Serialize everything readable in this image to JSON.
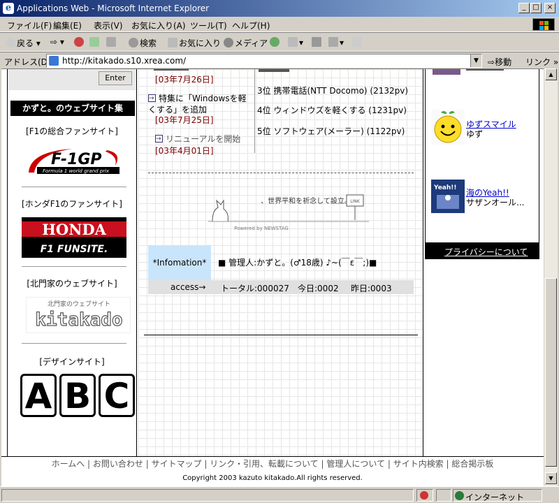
{
  "window": {
    "title": "Applications Web - Microsoft Internet Explorer",
    "min": "_",
    "max": "□",
    "close": "×"
  },
  "menu": [
    "ファイル(F)",
    "編集(E)",
    "表示(V)",
    "お気に入り(A)",
    "ツール(T)",
    "ヘルプ(H)"
  ],
  "toolbar": {
    "back": "戻る",
    "search": "検索",
    "favorites": "お気に入り",
    "media": "メディア"
  },
  "address": {
    "label": "アドレス(D)",
    "url": "http://kitakado.s10.xrea.com/",
    "go": "移動",
    "links": "リンク"
  },
  "left": {
    "enter": "Enter",
    "sites_title": "かずと。のウェブサイト集",
    "sites": [
      {
        "label": "[F1の総合ファンサイト]",
        "logo": "F-1GP",
        "logo_sub": "Formula 1 world grand prix"
      },
      {
        "label": "[ホンダF1のファンサイト]",
        "logo": "HONDA",
        "logo_sub": "F1 FUNSITE."
      },
      {
        "label": "[北門家のウェブサイト]",
        "logo": "kitakado",
        "logo_sub": "北門家のウェブサイト"
      },
      {
        "label": "[デザインサイト]",
        "logo": "ABC",
        "letters": [
          "A",
          "B",
          "C"
        ]
      }
    ]
  },
  "center": {
    "news": [
      {
        "title": "",
        "date": "[03年7月26日]"
      },
      {
        "title": "特集に「Windowsを軽くする」を追加",
        "date": "[03年7月25日]"
      },
      {
        "title": "リニューアルを開始",
        "date": "[03年4月01日]"
      }
    ],
    "ranking": [
      "3位  携帯電話(NTT Docomo)  (2132pv)",
      "4位  ウィンドウズを軽くする  (1231pv)",
      "5位  ソフトウェア(メーラー)  (1122pv)"
    ],
    "banner": {
      "text": "、世界平和を祈念して設立。",
      "powered": "Powered by NEWSTAG",
      "sign": "LINK"
    },
    "info": {
      "tag": "*Infomation*",
      "text": "■ 管理人:かずと。(♂18歳) ♪~(￣ε￣;)■"
    },
    "access": {
      "label": "access→",
      "total": "トータル:000027",
      "today": "今日:0002",
      "yesterday": "昨日:0003"
    }
  },
  "right": {
    "entries": [
      {
        "link": "ゆずスマイル",
        "sub": "ゆず"
      },
      {
        "link": "海のYeah!!",
        "sub": "サザンオール..."
      }
    ],
    "privacy": "プライバシーについて"
  },
  "footer": {
    "nav": [
      "ホームへ",
      "お問い合わせ",
      "サイトマップ",
      "リンク・引用、転載について",
      "管理人について",
      "サイト内検索",
      "総合掲示板"
    ],
    "separator": " | ",
    "copyright": "Copyright 2003 kazuto kitakado.All rights reserved."
  },
  "status": {
    "zone": "インターネット"
  },
  "colors": {
    "titlebar_start": "#0a246a",
    "date_red": "#7a0000",
    "info_blue": "#c9e5fb",
    "link_blue": "#0000cc"
  }
}
